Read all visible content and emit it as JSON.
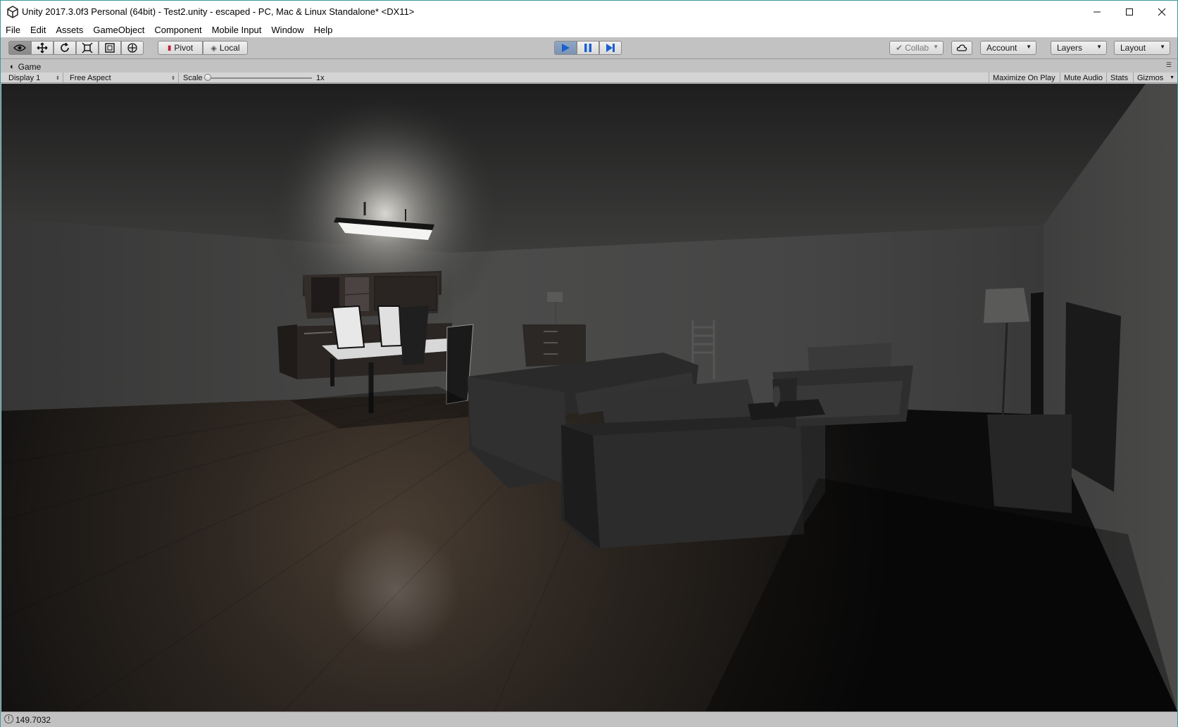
{
  "window": {
    "title": "Unity 2017.3.0f3 Personal (64bit) - Test2.unity - escaped - PC, Mac & Linux Standalone* <DX11>",
    "minimize_icon": "minimize-icon",
    "maximize_icon": "maximize-icon",
    "close_icon": "close-icon"
  },
  "menubar": {
    "items": [
      "File",
      "Edit",
      "Assets",
      "GameObject",
      "Component",
      "Mobile Input",
      "Window",
      "Help"
    ]
  },
  "toolbar": {
    "tools": [
      "eye-icon",
      "move-icon",
      "rotate-icon",
      "scale-icon",
      "rect-icon",
      "transform-icon"
    ],
    "pivot_label": "Pivot",
    "local_label": "Local",
    "play_icon": "play-icon",
    "pause_icon": "pause-icon",
    "step_icon": "step-icon",
    "collab_label": "Collab",
    "account_label": "Account",
    "layers_label": "Layers",
    "layout_label": "Layout",
    "accent_color": "#2e6fd6"
  },
  "game_view": {
    "tab_label": "Game",
    "display_label": "Display 1",
    "aspect_label": "Free Aspect",
    "scale_label": "Scale",
    "scale_value": "1x",
    "scale_fraction": 0.0,
    "maximize_on_play": "Maximize On Play",
    "mute_audio": "Mute Audio",
    "stats": "Stats",
    "gizmos": "Gizmos"
  },
  "statusbar": {
    "text": "149.7032"
  }
}
